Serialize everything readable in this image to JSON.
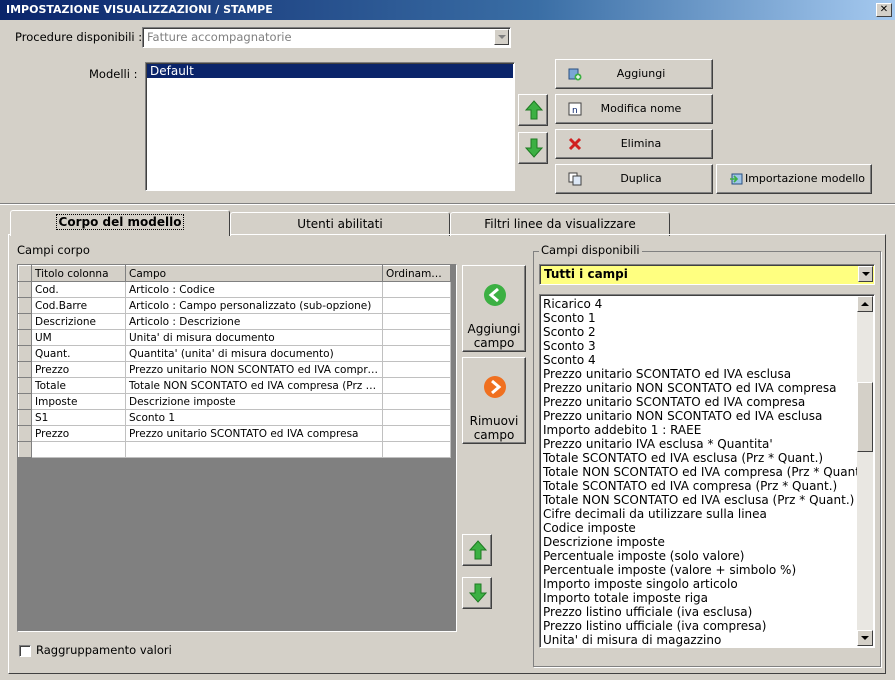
{
  "window": {
    "title": "IMPOSTAZIONE VISUALIZZAZIONI / STAMPE",
    "close_glyph": "✕"
  },
  "procedure": {
    "label": "Procedure disponibili :",
    "value": "Fatture accompagnatorie"
  },
  "modelli": {
    "label": "Modelli :",
    "items": [
      "Default"
    ]
  },
  "buttons": {
    "aggiungi": "Aggiungi",
    "modifica_nome": "Modifica nome",
    "elimina": "Elimina",
    "duplica": "Duplica",
    "importazione": "Importazione modello",
    "aggiungi_campo": [
      "Aggiungi",
      "campo"
    ],
    "rimuovi_campo": [
      "Rimuovi",
      "campo"
    ]
  },
  "tabs": [
    {
      "label": "Corpo del modello",
      "active": true
    },
    {
      "label": "Utenti abilitati",
      "active": false
    },
    {
      "label": "Filtri linee da visualizzare",
      "active": false
    }
  ],
  "campi_corpo": {
    "label": "Campi corpo",
    "columns": [
      "Titolo colonna",
      "Campo",
      "Ordiname..."
    ],
    "rows": [
      [
        "Cod.",
        "Articolo : Codice",
        ""
      ],
      [
        "Cod.Barre",
        "Articolo : Campo personalizzato (sub-opzione)",
        ""
      ],
      [
        "Descrizione",
        "Articolo : Descrizione",
        ""
      ],
      [
        "UM",
        "Unita' di misura documento",
        ""
      ],
      [
        "Quant.",
        "Quantita' (unita' di misura documento)",
        ""
      ],
      [
        "Prezzo",
        "Prezzo unitario NON SCONTATO ed IVA compresa",
        ""
      ],
      [
        "Totale",
        "Totale NON SCONTATO ed IVA compresa (Prz * Q...",
        ""
      ],
      [
        "Imposte",
        "Descrizione imposte",
        ""
      ],
      [
        "S1",
        "Sconto 1",
        ""
      ],
      [
        "Prezzo",
        "Prezzo unitario SCONTATO ed IVA compresa",
        ""
      ],
      [
        "",
        "",
        ""
      ]
    ]
  },
  "raggruppamento": {
    "label": "Raggruppamento valori",
    "checked": false
  },
  "campi_disponibili": {
    "label": "Campi disponibili",
    "filter": "Tutti i campi",
    "filter_color": "#ffff80",
    "items": [
      "Ricarico 4",
      "Sconto 1",
      "Sconto 2",
      "Sconto 3",
      "Sconto 4",
      "Prezzo unitario SCONTATO ed IVA esclusa",
      "Prezzo unitario NON SCONTATO ed IVA compresa",
      "Prezzo unitario SCONTATO ed IVA compresa",
      "Prezzo unitario NON SCONTATO ed IVA esclusa",
      "Importo addebito 1 : RAEE",
      "Prezzo unitario IVA esclusa * Quantita'",
      "Totale SCONTATO ed IVA esclusa (Prz * Quant.)",
      "Totale NON SCONTATO ed IVA compresa (Prz * Quant.)",
      "Totale SCONTATO ed IVA compresa (Prz * Quant.)",
      "Totale NON SCONTATO ed IVA esclusa (Prz * Quant.)",
      "Cifre decimali da utilizzare sulla linea",
      "Codice imposte",
      "Descrizione imposte",
      "Percentuale imposte (solo valore)",
      "Percentuale imposte (valore + simbolo %)",
      "Importo imposte singolo articolo",
      "Importo totale imposte riga",
      "Prezzo listino ufficiale (iva esclusa)",
      "Prezzo listino ufficiale (iva compresa)",
      "Unita' di misura di magazzino"
    ]
  },
  "colors": {
    "selection": "#0a246a",
    "arrow_green": "#3cb043",
    "add_circle_green": "#3cb043",
    "remove_circle_orange": "#f07020"
  }
}
